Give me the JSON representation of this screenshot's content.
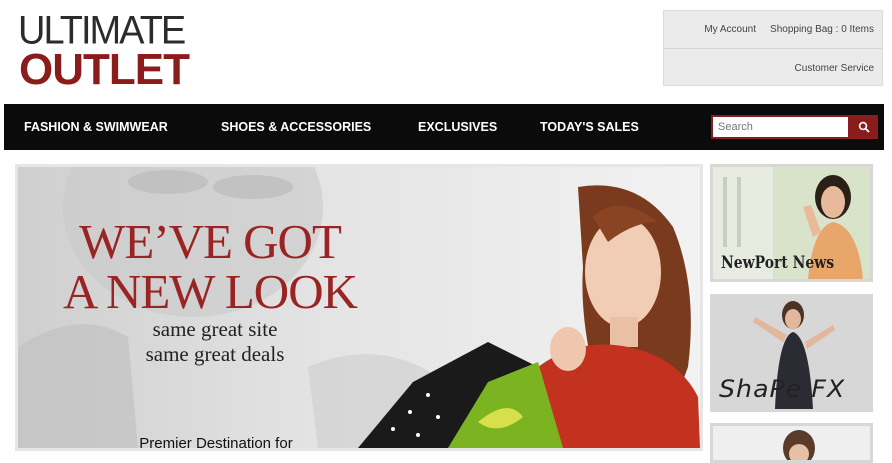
{
  "logo": {
    "line1": "ULTIMATE",
    "line2": "OUTLET"
  },
  "account": {
    "my_account": "My Account",
    "shopping_bag": "Shopping Bag : 0 Items",
    "customer_service": "Customer Service"
  },
  "nav": {
    "items": [
      "FASHION & SWIMWEAR",
      "SHOES & ACCESSORIES",
      "EXCLUSIVES",
      "TODAY'S SALES"
    ]
  },
  "search": {
    "placeholder": "Search",
    "icon": "search-icon"
  },
  "hero": {
    "title_line1": "WE’VE GOT",
    "title_line2": "A NEW LOOK",
    "subtitle_line1": "same great site",
    "subtitle_line2": "same great deals",
    "footer_text": "Premier Destination for"
  },
  "tiles": [
    {
      "label": "NewPort News"
    },
    {
      "label": "ShaPe FX"
    }
  ],
  "colors": {
    "brand_red": "#8b1c1c",
    "nav_bg": "#0b0b0b",
    "hero_title": "#9a2323"
  }
}
